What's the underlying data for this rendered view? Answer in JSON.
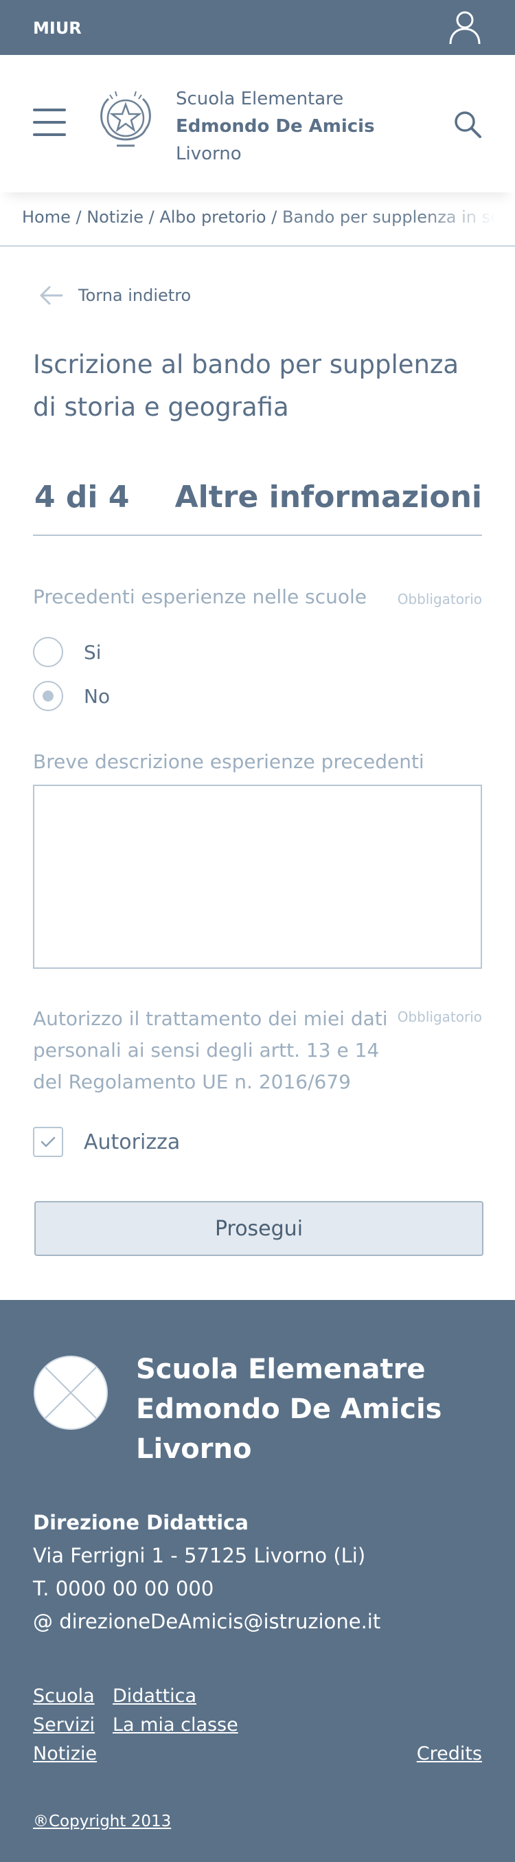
{
  "topbar": {
    "brand": "MIUR",
    "user_icon": "user-icon"
  },
  "header": {
    "menu_icon": "hamburger-menu-icon",
    "emblem": "italian-republic-emblem",
    "school_line1": "Scuola Elementare",
    "school_line2": "Edmondo De Amicis",
    "school_line3": "Livorno",
    "search_icon": "search-icon"
  },
  "breadcrumb": {
    "home": "Home",
    "news": "Notizie",
    "board": "Albo pretorio",
    "current": "Bando per supplenza in scuola",
    "separator": " / "
  },
  "back": {
    "label": "Torna indietro"
  },
  "page_title": "Iscrizione al bando per supplenza di storia e geografia",
  "steps": {
    "counter": "4 di 4",
    "step_name": "Altre informazioni"
  },
  "form": {
    "experience": {
      "label": "Precedenti esperienze nelle scuole",
      "required": "Obbligatorio",
      "options": [
        {
          "label": "Si",
          "selected": false
        },
        {
          "label": "No",
          "selected": true
        }
      ]
    },
    "description": {
      "label": "Breve descrizione esperienze precedenti",
      "value": ""
    },
    "privacy": {
      "label": "Autorizzo il trattamento dei miei dati personali ai sensi degli artt. 13 e 14 del Regolamento UE n. 2016/679",
      "required": "Obbligatorio",
      "checkbox_label": "Autorizza",
      "checked": true
    },
    "submit_label": "Prosegui"
  },
  "footer": {
    "school_line1": "Scuola Elemenatre",
    "school_line2": "Edmondo De Amicis",
    "school_line3": "Livorno",
    "direction_heading": "Direzione Didattica",
    "address": "Via Ferrigni 1 - 57125 Livorno (Li)",
    "phone": "T. 0000 00 00 000",
    "email": "@ direzioneDeAmicis@istruzione.it",
    "links_col1": [
      "Scuola",
      "Servizi",
      "Notizie"
    ],
    "links_col2": [
      "Didattica",
      "La mia classe"
    ],
    "credits": "Credits",
    "copyright": "®Copyright 2013"
  },
  "colors": {
    "primary": "#5a7188",
    "text": "#5a7088",
    "muted": "#9caebf",
    "border": "#b7c6d4",
    "button_bg": "#e3e9f0"
  }
}
